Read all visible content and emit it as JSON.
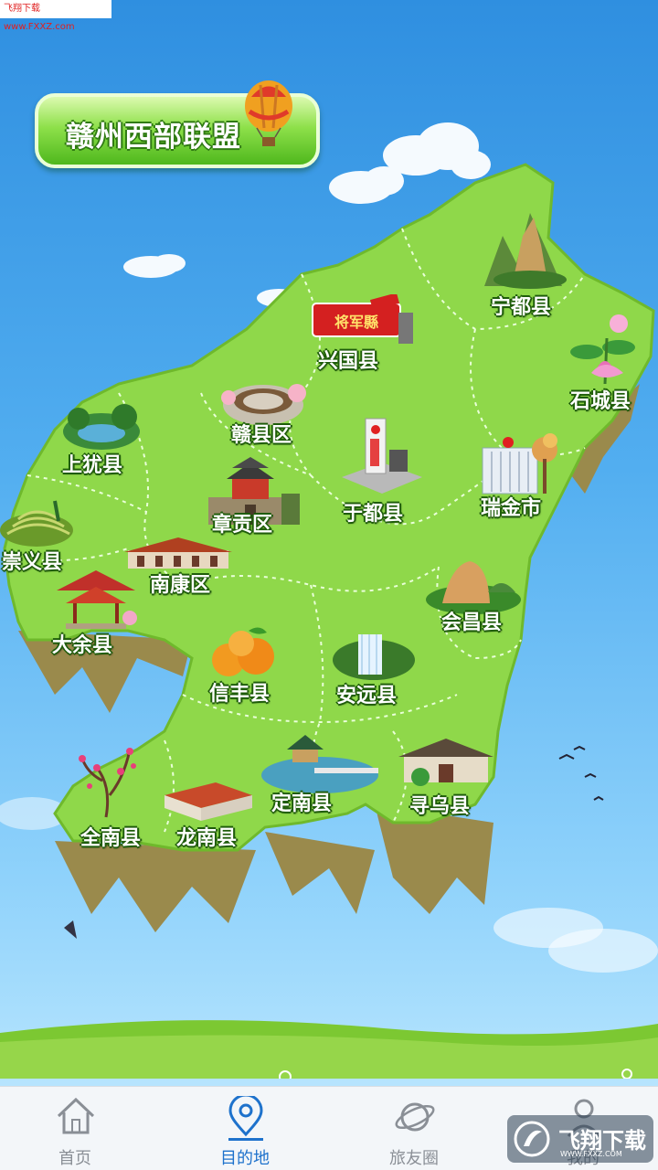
{
  "watermark": {
    "top_text": "飞翔下载 www.FXXZ.com",
    "br_text": "飞翔下载",
    "br_sub": "WWW.FXXZ.COM"
  },
  "header": {
    "title": "赣州西部联盟"
  },
  "counties": [
    {
      "id": "ningdu",
      "name": "宁都县"
    },
    {
      "id": "xingguo",
      "name": "兴国县"
    },
    {
      "id": "shicheng",
      "name": "石城县"
    },
    {
      "id": "ganxian",
      "name": "赣县区"
    },
    {
      "id": "shangyou",
      "name": "上犹县"
    },
    {
      "id": "yudu",
      "name": "于都县"
    },
    {
      "id": "ruijin",
      "name": "瑞金市"
    },
    {
      "id": "zhanggong",
      "name": "章贡区"
    },
    {
      "id": "chongyi",
      "name": "崇义县"
    },
    {
      "id": "nankang",
      "name": "南康区"
    },
    {
      "id": "huichang",
      "name": "会昌县"
    },
    {
      "id": "dayu",
      "name": "大余县"
    },
    {
      "id": "xinfeng",
      "name": "信丰县"
    },
    {
      "id": "anyuan",
      "name": "安远县"
    },
    {
      "id": "dingnan",
      "name": "定南县"
    },
    {
      "id": "xunwu",
      "name": "寻乌县"
    },
    {
      "id": "quannan",
      "name": "全南县"
    },
    {
      "id": "longnan",
      "name": "龙南县"
    }
  ],
  "xingguo_sign": "将军縣",
  "tabs": [
    {
      "label": "首页",
      "icon": "home-icon",
      "active": false
    },
    {
      "label": "目的地",
      "icon": "location-pin-icon",
      "active": true
    },
    {
      "label": "旅友圈",
      "icon": "planet-icon",
      "active": false
    },
    {
      "label": "我的",
      "icon": "user-icon",
      "active": false
    }
  ],
  "colors": {
    "active_tab": "#1e72cc",
    "inactive_tab": "#8a8f96",
    "map_green": "#8fd84a"
  }
}
